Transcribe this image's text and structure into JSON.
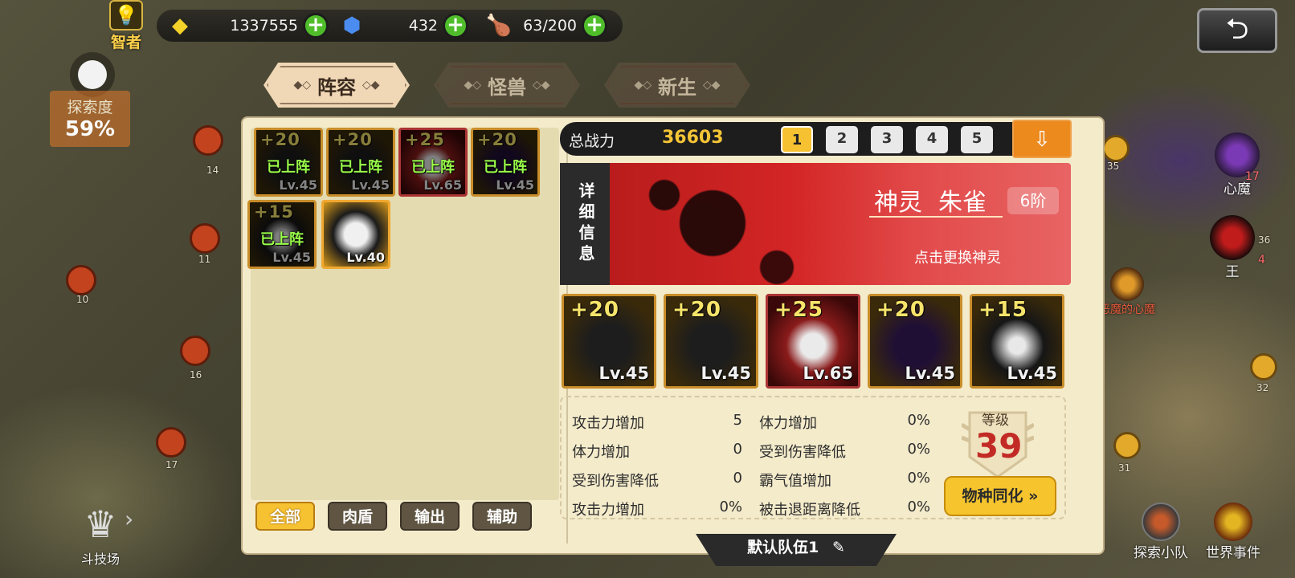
{
  "header": {
    "sage_label": "智者",
    "resources": {
      "gold": "1337555",
      "gems": "432",
      "meat": "63/200"
    },
    "back_icon": "back-arrow-icon"
  },
  "explore": {
    "label": "探索度",
    "value": "59%"
  },
  "map": {
    "nodes": [
      "14",
      "11",
      "10",
      "16",
      "17"
    ],
    "right_nodes": [
      "35",
      "17",
      "36",
      "4",
      "32",
      "31"
    ]
  },
  "right_menu": {
    "heart_demon": "心魔",
    "king": "王",
    "explore_team": "探索小队",
    "world_event": "世界事件",
    "heart_demon_sub": "恶魔的心魔"
  },
  "arena_label": "斗技场",
  "tabs": [
    {
      "label": "阵容",
      "active": true
    },
    {
      "label": "怪兽",
      "active": false
    },
    {
      "label": "新生",
      "active": false
    }
  ],
  "roster": {
    "cards": [
      {
        "plus": "+20",
        "level": "Lv.45",
        "deployed": "已上阵",
        "style": "dark"
      },
      {
        "plus": "+20",
        "level": "Lv.45",
        "deployed": "已上阵",
        "style": "dark"
      },
      {
        "plus": "+25",
        "level": "Lv.65",
        "deployed": "已上阵",
        "style": "red"
      },
      {
        "plus": "+20",
        "level": "Lv.45",
        "deployed": "已上阵",
        "style": "purple"
      },
      {
        "plus": "+15",
        "level": "Lv.45",
        "deployed": "已上阵",
        "style": "white"
      },
      {
        "plus": "",
        "level": "Lv.40",
        "deployed": "",
        "style": "tiger"
      }
    ],
    "filters": [
      "全部",
      "肉盾",
      "输出",
      "辅助"
    ]
  },
  "team": {
    "power_label": "总战力",
    "power_value": "36603",
    "slots": [
      "1",
      "2",
      "3",
      "4",
      "5"
    ],
    "active_slot": "1",
    "name": "默认队伍1"
  },
  "spirit": {
    "detail_label": "详细信息",
    "type": "神灵",
    "name": "朱雀",
    "rank": "6阶",
    "hint": "点击更换神灵"
  },
  "lineup": [
    {
      "plus": "+20",
      "level": "Lv.45",
      "style": "dark"
    },
    {
      "plus": "+20",
      "level": "Lv.45",
      "style": "dark"
    },
    {
      "plus": "+25",
      "level": "Lv.65",
      "style": "red"
    },
    {
      "plus": "+20",
      "level": "Lv.45",
      "style": "purple"
    },
    {
      "plus": "+15",
      "level": "Lv.45",
      "style": "white"
    }
  ],
  "stats": [
    {
      "label": "攻击力增加",
      "value": "5"
    },
    {
      "label": "体力增加",
      "value": "0"
    },
    {
      "label": "受到伤害降低",
      "value": "0"
    },
    {
      "label": "攻击力增加",
      "value": "0%"
    },
    {
      "label": "体力增加",
      "value": "0%"
    },
    {
      "label": "受到伤害降低",
      "value": "0%"
    },
    {
      "label": "霸气值增加",
      "value": "0%"
    },
    {
      "label": "被击退距离降低",
      "value": "0%"
    }
  ],
  "level": {
    "label": "等级",
    "value": "39"
  },
  "sync_button": "物种同化"
}
